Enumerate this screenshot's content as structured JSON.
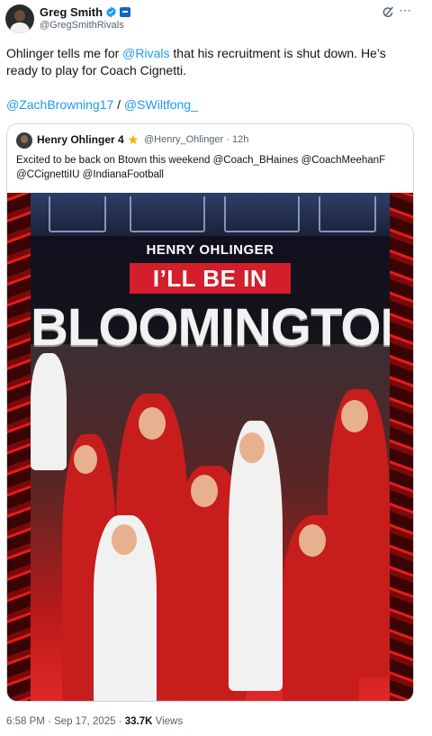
{
  "post": {
    "author_name": "Greg Smith",
    "author_handle": "@GregSmithRivals",
    "text_part1": "Ohlinger tells me for ",
    "text_link": "@Rivals",
    "text_part2": " that his recruitment is shut down. He’s ready to play for Coach Cignetti.",
    "mention1": "@ZachBrowning17",
    "mention_separator": " / ",
    "mention2": "@SWiltfong_",
    "time": "6:58 PM",
    "date_separator": " · ",
    "date": "Sep 17, 2025",
    "views_separator": " · ",
    "views_count": "33.7K",
    "views_label": " Views",
    "more_icon": "⋯"
  },
  "quote": {
    "author_name": "Henry Ohlinger 4",
    "author_handle": "@Henry_Ohlinger · 12h",
    "text": "Excited to be back on Btown this weekend @Coach_BHaines @CoachMeehanF @CCignettiIU @IndianaFootball"
  },
  "graphic": {
    "name_line": "HENRY OHLINGER",
    "badge_line": "I’LL BE IN",
    "big_line": "BLOOMINGTON"
  },
  "colors": {
    "link": "#1d9bf0",
    "verified": "#1d9bf0",
    "accent_red": "#d41e2b",
    "muted_text": "#536471"
  }
}
